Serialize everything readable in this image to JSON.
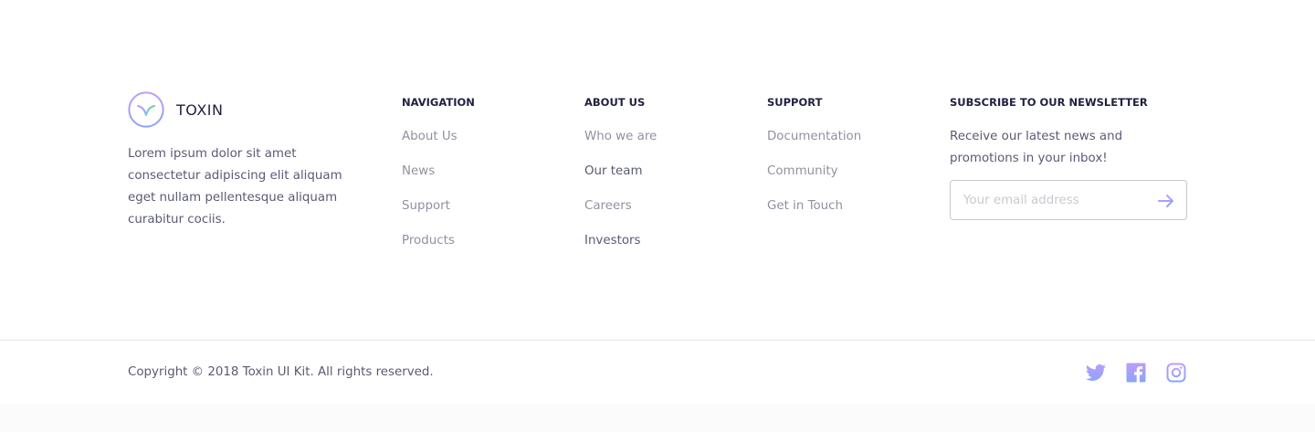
{
  "brand": {
    "name": "TOXIN",
    "description": "Lorem ipsum dolor sit amet consectetur adipiscing elit aliquam eget nullam pellentesque aliquam curabitur cociis."
  },
  "columns": {
    "navigation": {
      "title": "NAVIGATION",
      "links": [
        "About Us",
        "News",
        "Support",
        "Products"
      ]
    },
    "about": {
      "title": "ABOUT US",
      "links": [
        "Who we are",
        "Our team",
        "Careers",
        "Investors"
      ]
    },
    "support": {
      "title": "SUPPORT",
      "links": [
        "Documentation",
        "Community",
        "Get in Touch"
      ]
    }
  },
  "newsletter": {
    "title": "SUBSCRIBE TO OUR NEWSLETTER",
    "description": "Receive our latest news and promotions in your inbox!",
    "email_placeholder": "Your email address",
    "submit_icon": "arrow-right-icon"
  },
  "bottom": {
    "copyright": "Copyright © 2018 Toxin UI Kit. All rights reserved.",
    "social": [
      "twitter-icon",
      "facebook-icon",
      "instagram-icon"
    ]
  },
  "colors": {
    "text_dark": "#1f2041",
    "accent_start": "#bc9cff",
    "accent_end": "#8ba4f9",
    "accent_green_start": "#6fcf97",
    "accent_green_end": "#66d2ea"
  }
}
